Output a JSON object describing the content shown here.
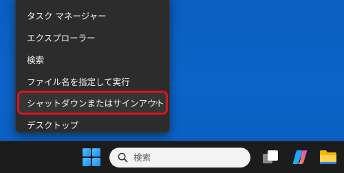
{
  "menu": {
    "items": [
      {
        "label": "タスク マネージャー",
        "icon": "none"
      },
      {
        "label": "エクスプローラー",
        "icon": "none"
      },
      {
        "label": "検索",
        "icon": "none"
      },
      {
        "label": "ファイル名を指定して実行",
        "icon": "none"
      },
      {
        "label": "シャットダウンまたはサインアウト",
        "icon": "none",
        "submenu_chevron": "›",
        "highlighted": true,
        "highlight_color": "#d9141e"
      },
      {
        "label": "デスクトップ",
        "icon": "none"
      }
    ]
  },
  "taskbar": {
    "start_icon": "windows-start-icon",
    "search": {
      "placeholder": "検索",
      "value": "",
      "icon": "search-icon"
    },
    "task_view_icon": "task-view-icon",
    "copilot_icon": "copilot-icon",
    "explorer_icon": "folder-icon"
  },
  "colors": {
    "desktop": "#0a62c4",
    "menu_bg": "#2c2c2c",
    "taskbar_bg": "#1c1c1c",
    "highlight": "#d9141e"
  }
}
